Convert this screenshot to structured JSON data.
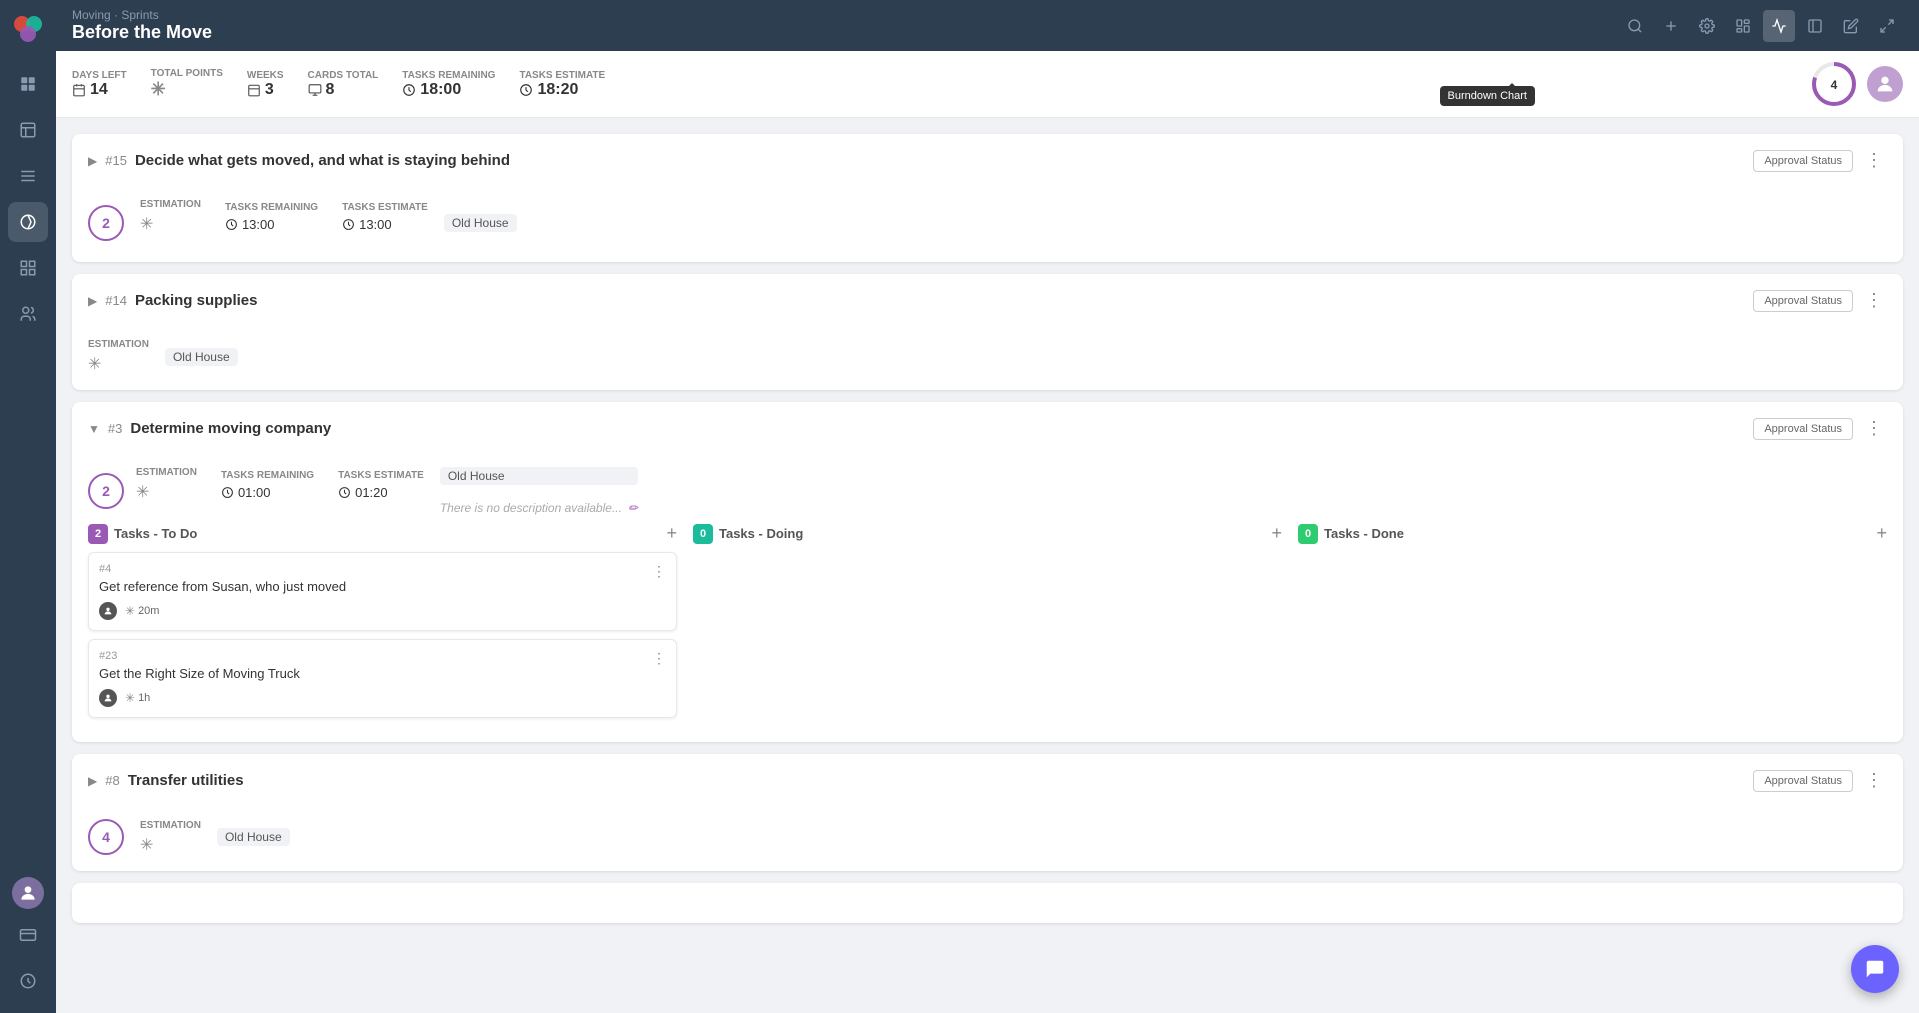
{
  "app": {
    "logo": "🌀",
    "breadcrumb": "Moving · Sprints",
    "title": "Before the Move"
  },
  "stats": {
    "days_left_label": "DAYS LEFT",
    "days_left": "14",
    "total_points_label": "TOTAL POINTS",
    "total_points": "*",
    "weeks_label": "WEEKS",
    "weeks": "3",
    "cards_total_label": "CARDS TOTAL",
    "cards_total": "8",
    "tasks_remaining_label": "TASKS REMAINING",
    "tasks_remaining": "18:00",
    "tasks_estimate_label": "TASKS ESTIMATE",
    "tasks_estimate": "18:20"
  },
  "toolbar": {
    "add_label": "+",
    "settings_label": "⚙",
    "board_label": "⊞",
    "chart_label": "📈",
    "list_label": "▬",
    "edit_label": "✏",
    "fullscreen_label": "⛶",
    "search_label": "🔍",
    "burndown_tooltip": "Burndown Chart"
  },
  "stories": [
    {
      "id": "story-15",
      "number": "#15",
      "title": "Decide what gets moved, and what is staying behind",
      "approval_label": "Approval Status",
      "circle_value": "2",
      "estimation_label": "ESTIMATION",
      "estimation_value": "*",
      "tasks_remaining_label": "TASKS REMAINING",
      "tasks_remaining": "13:00",
      "tasks_estimate_label": "TASKS ESTIMATE",
      "tasks_estimate": "13:00",
      "tag": "Old House",
      "expanded": false
    },
    {
      "id": "story-14",
      "number": "#14",
      "title": "Packing supplies",
      "approval_label": "Approval Status",
      "circle_value": "",
      "estimation_label": "ESTIMATION",
      "estimation_value": "*",
      "tag": "Old House",
      "expanded": false
    },
    {
      "id": "story-3",
      "number": "#3",
      "title": "Determine moving company",
      "approval_label": "Approval Status",
      "circle_value": "2",
      "estimation_label": "ESTIMATION",
      "estimation_value": "*",
      "tasks_remaining_label": "TASKS REMAINING",
      "tasks_remaining": "01:00",
      "tasks_estimate_label": "TASKS ESTIMATE",
      "tasks_estimate": "01:20",
      "tag": "Old House",
      "description": "There is no description available...",
      "expanded": true,
      "kanban": {
        "todo": {
          "badge": "2",
          "label": "Tasks - To Do",
          "color": "purple",
          "tasks": [
            {
              "num": "#4",
              "title": "Get reference from Susan, who just moved",
              "time": "20m"
            },
            {
              "num": "#23",
              "title": "Get the Right Size of Moving Truck",
              "time": "1h"
            }
          ]
        },
        "doing": {
          "badge": "0",
          "label": "Tasks - Doing",
          "color": "teal",
          "tasks": []
        },
        "done": {
          "badge": "0",
          "label": "Tasks - Done",
          "color": "green",
          "tasks": []
        }
      }
    },
    {
      "id": "story-8",
      "number": "#8",
      "title": "Transfer utilities",
      "approval_label": "Approval Status",
      "circle_value": "4",
      "estimation_label": "ESTIMATION",
      "estimation_value": "*",
      "tag": "Old House",
      "expanded": false
    }
  ],
  "sidebar": {
    "items": [
      {
        "icon": "⊞",
        "name": "dashboard"
      },
      {
        "icon": "📊",
        "name": "reports"
      },
      {
        "icon": "☰",
        "name": "menu"
      },
      {
        "icon": "🏃",
        "name": "sprints",
        "active": true
      },
      {
        "icon": "▦",
        "name": "grid"
      },
      {
        "icon": "👥",
        "name": "team"
      }
    ],
    "bottom_items": [
      {
        "icon": "💳",
        "name": "billing"
      },
      {
        "icon": "↗",
        "name": "expand"
      }
    ]
  }
}
